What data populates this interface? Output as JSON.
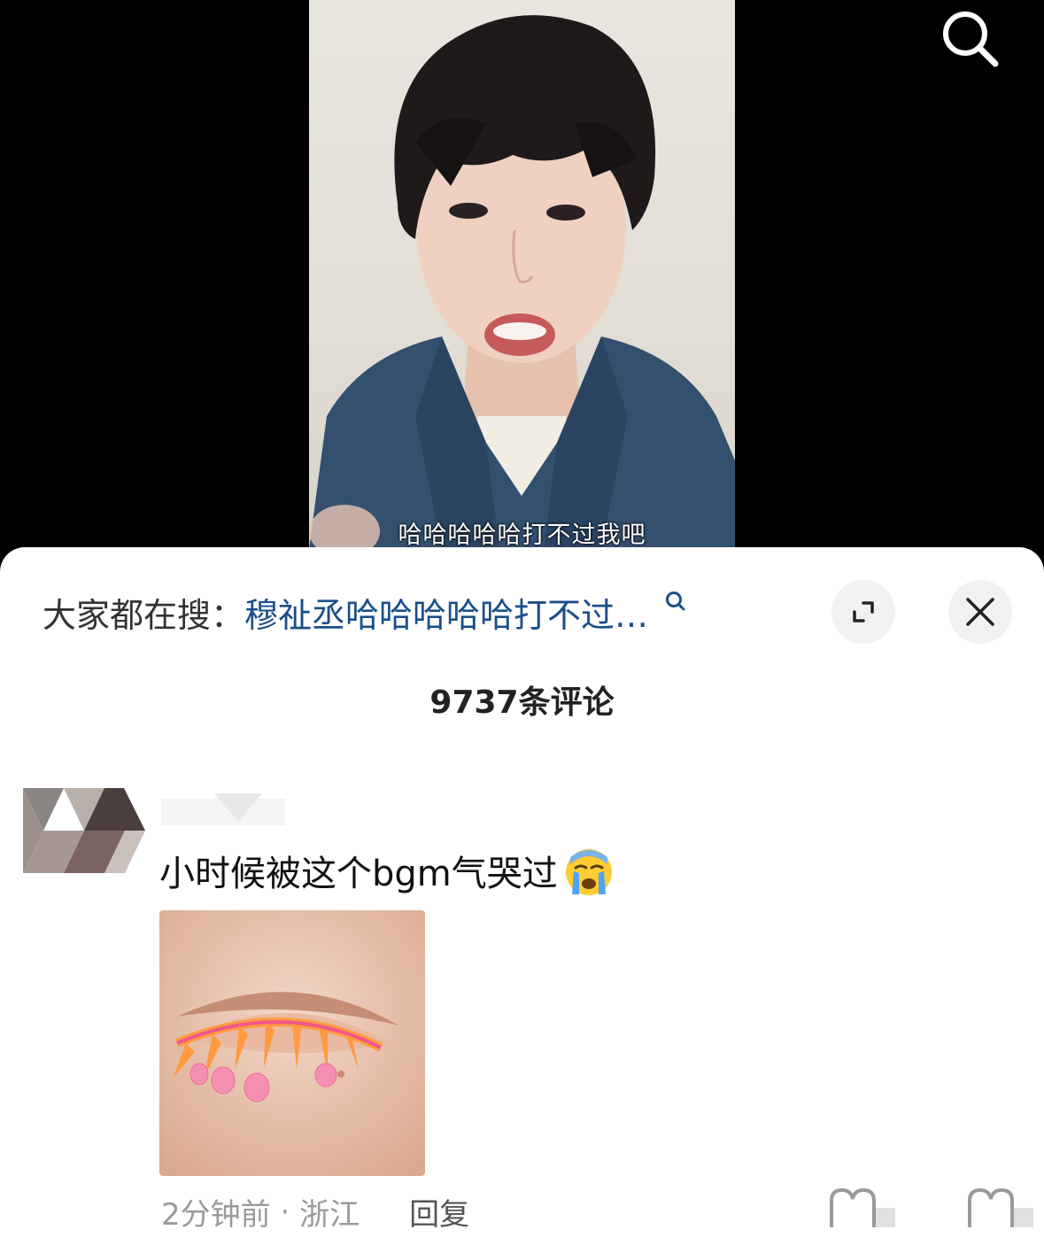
{
  "video": {
    "subtitle": "哈哈哈哈哈打不过我吧"
  },
  "icons": {
    "search": "search-icon",
    "small_search": "small-search-icon",
    "expand": "expand-icon",
    "close": "close-icon",
    "emoji": "crying-face-emoji",
    "like": "like-icon",
    "dislike": "dislike-icon"
  },
  "colors": {
    "hot_keyword": "#1a4e8a",
    "panel_bg": "#ffffff",
    "meta_text": "#9a9a9a"
  },
  "panel": {
    "hot_search_prefix": "大家都在搜：",
    "hot_search_keyword": "穆祉丞哈哈哈哈哈打不过…",
    "comment_count": "9737条评论"
  },
  "comment": {
    "username": "",
    "text": "小时候被这个bgm气哭过",
    "time": "2分钟前",
    "separator": " · ",
    "location": "浙江",
    "reply_label": "回复"
  }
}
